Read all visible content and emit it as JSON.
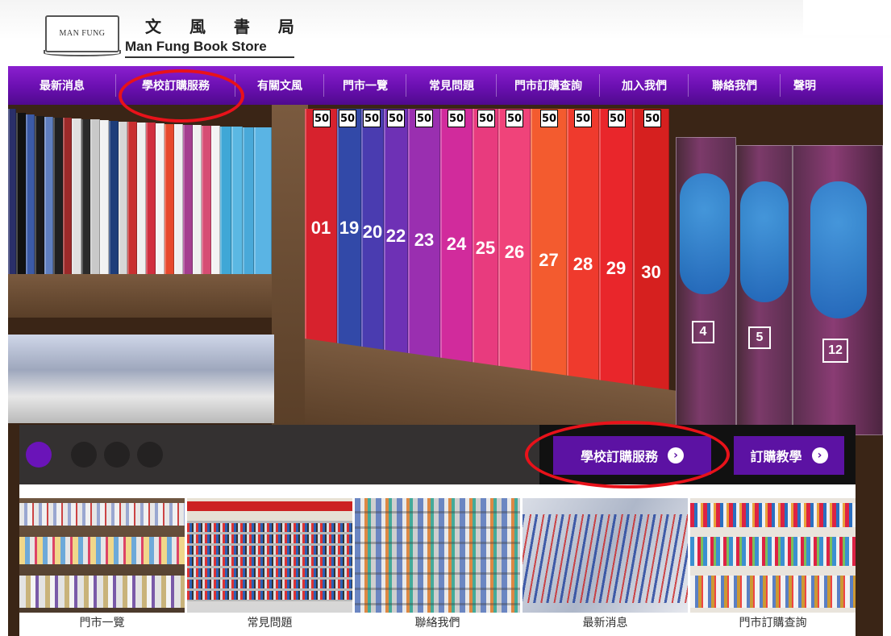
{
  "header": {
    "logo_text": "MAN FUNG",
    "brand_cn": "文 風 書 局",
    "brand_en": "Man Fung Book Store"
  },
  "nav": {
    "items": [
      {
        "label": "最新消息"
      },
      {
        "label": "學校訂購服務"
      },
      {
        "label": "有關文風"
      },
      {
        "label": "門市一覽"
      },
      {
        "label": "常見問題"
      },
      {
        "label": "門市訂購查詢"
      },
      {
        "label": "加入我們"
      },
      {
        "label": "聯絡我們"
      },
      {
        "label": "聲明"
      }
    ]
  },
  "hero": {
    "volumes": [
      "01",
      "19",
      "20",
      "22",
      "23",
      "24",
      "25",
      "26",
      "27",
      "28",
      "29",
      "30"
    ],
    "badge": "50",
    "case_numbers": [
      "4",
      "5",
      "12"
    ]
  },
  "slider": {
    "dots": 4,
    "active_dot": 0,
    "cta_primary": "學校訂購服務",
    "cta_secondary": "訂購教學",
    "cta_arrow": "›"
  },
  "thumbnails": [
    {
      "label": "門市一覽"
    },
    {
      "label": "常見問題"
    },
    {
      "label": "聯絡我們"
    },
    {
      "label": "最新消息"
    },
    {
      "label": "門市訂購查詢"
    }
  ],
  "colors": {
    "nav_purple": "#6a0fb0",
    "cta_purple": "#5c12a3",
    "annotation_red": "#e8121a"
  }
}
